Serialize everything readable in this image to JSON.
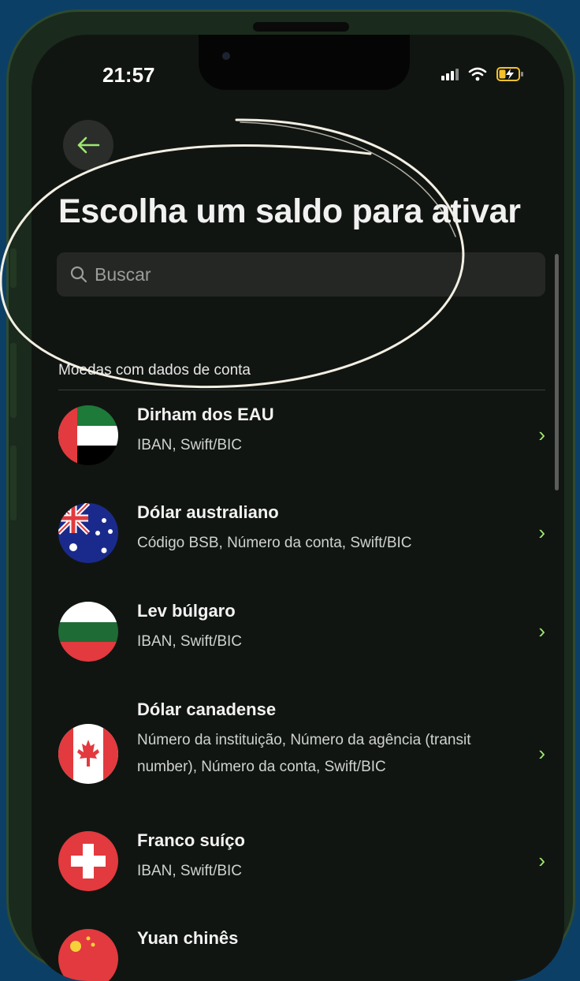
{
  "status_bar": {
    "time": "21:57"
  },
  "header": {
    "title": "Escolha um saldo para ativar",
    "search_placeholder": "Buscar"
  },
  "section": {
    "title": "Moedas com dados de conta"
  },
  "currencies": [
    {
      "name": "Dirham dos EAU",
      "details": "IBAN, Swift/BIC",
      "flag": "ae-flag-icon"
    },
    {
      "name": "Dólar australiano",
      "details": "Código BSB, Número da conta, Swift/BIC",
      "flag": "au-flag-icon"
    },
    {
      "name": "Lev búlgaro",
      "details": "IBAN, Swift/BIC",
      "flag": "bg-flag-icon"
    },
    {
      "name": "Dólar canadense",
      "details": "Número da instituição, Número da agência (transit number), Número da conta, Swift/BIC",
      "flag": "ca-flag-icon"
    },
    {
      "name": "Franco suíço",
      "details": "IBAN, Swift/BIC",
      "flag": "ch-flag-icon"
    },
    {
      "name": "Yuan chinês",
      "details": "",
      "flag": "cn-flag-icon"
    }
  ],
  "colors": {
    "accent": "#9fe870",
    "background": "#111511",
    "outer": "#0c3f66"
  }
}
